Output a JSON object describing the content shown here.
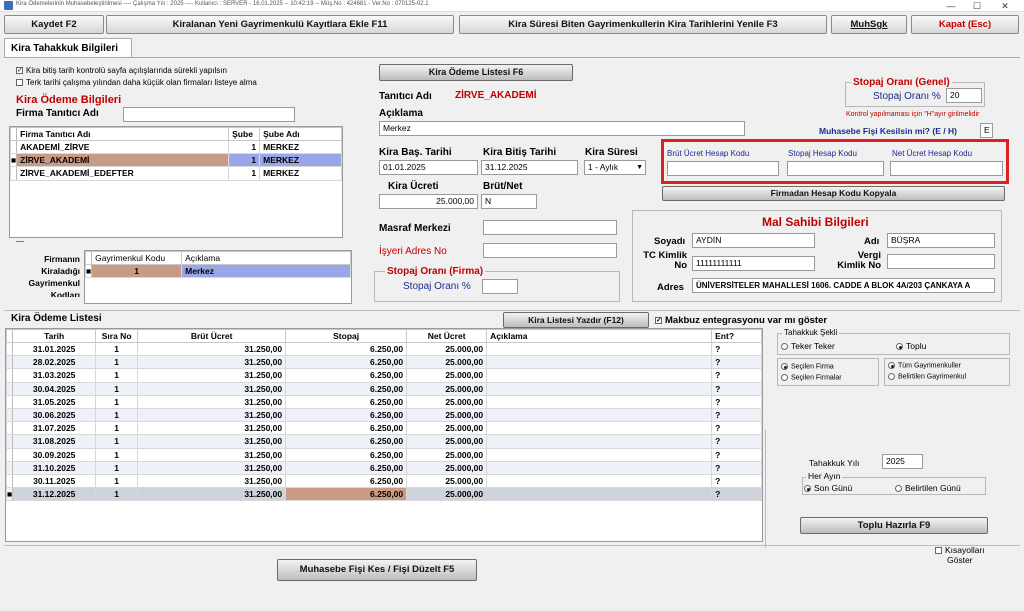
{
  "titlebar": {
    "text": "Kira Ödemelerinin Muhasebeleştirilmesi ---- Çalışma Yılı : 2025 ---- Kullanıcı : SERVER - 16.01.2025 -- 10:42:19 -- Müş.No : 424681 - Ver.No : 070125-02.1",
    "minimize": "—",
    "maximize": "☐",
    "close": "✕"
  },
  "toolbar": {
    "save": "Kaydet F2",
    "add_new": "Kiralanan Yeni Gayrimenkulü Kayıtlara Ekle F11",
    "renew": "Kira Süresi Biten Gayrimenkullerin Kira Tarihlerini Yenile F3",
    "muhsgk": "MuhSgk",
    "close": "Kapat (Esc)"
  },
  "tab": "Kira Tahakkuk Bilgileri",
  "options": {
    "check1": "Kira bitiş tarih kontrolü sayfa açılışlarında sürekli yapılsın",
    "check2": "Terk tarihi çalışma yılından daha küçük olan firmaları listeye alma"
  },
  "payment_info": {
    "heading": "Kira Ödeme Bilgileri",
    "firm_alias_label": "Firma Tanıtıcı Adı",
    "firm_alias_value": ""
  },
  "firm_grid": {
    "headers": [
      "Firma Tanıtıcı Adı",
      "Şube",
      "Şube Adı"
    ],
    "rows": [
      [
        "AKADEMİ_ZİRVE",
        "1",
        "MERKEZ"
      ],
      [
        "ZİRVE_AKADEMİ",
        "1",
        "MERKEZ"
      ],
      [
        "ZİRVE_AKADEMİ_EDEFTER",
        "1",
        "MERKEZ"
      ]
    ]
  },
  "property_grid": {
    "side_label": "Firmanın Kiraladığı Gayrimenkul Kodları",
    "headers": [
      "Gayrimenkul Kodu",
      "Açıklama"
    ],
    "rows": [
      [
        "1",
        "Merkez"
      ]
    ]
  },
  "list_button": "Kira Ödeme Listesi F6",
  "detail": {
    "alias_label": "Tanıtıcı Adı",
    "alias_value": "ZİRVE_AKADEMİ",
    "desc_label": "Açıklama",
    "desc_value": "Merkez",
    "start_label": "Kira Baş. Tarihi",
    "start_value": "01.01.2025",
    "end_label": "Kira Bitiş Tarihi",
    "end_value": "31.12.2025",
    "period_label": "Kira Süresi",
    "period_value": "1 - Aylık",
    "fee_label": "Kira Ücreti",
    "fee_value": "25.000,00",
    "gross_net_label": "Brüt/Net",
    "gross_net_value": "N",
    "cost_center_label": "Masraf Merkezi",
    "workplace_label": "İşyeri Adres No",
    "firm_rate_heading": "Stopaj Oranı (Firma)",
    "firm_rate_label": "Stopaj Oranı %",
    "firm_rate_value": ""
  },
  "general_rate": {
    "heading": "Stopaj Oranı (Genel)",
    "label": "Stopaj Oranı %",
    "value": "20",
    "note": "Kontrol yapılmaması için \"H\"ayır girilmelidir",
    "voucher_label": "Muhasebe Fişi Kesilsin mi? (E / H)",
    "voucher_value": "E"
  },
  "account_codes": {
    "gross": "Brüt Ücret Hesap Kodu",
    "withholding": "Stopaj Hesap Kodu",
    "net": "Net Ücret Hesap Kodu",
    "copy_button": "Firmadan Hesap Kodu Kopyala"
  },
  "owner": {
    "heading": "Mal Sahibi Bilgileri",
    "surname_label": "Soyadı",
    "surname_value": "AYDİN",
    "name_label": "Adı",
    "name_value": "BÜŞRA",
    "tc_label": "TC Kimlik No",
    "tc_value": "11111111111",
    "tax_label": "Vergi Kimlik No",
    "tax_value": "",
    "address_label": "Adres",
    "address_value": "ÜNİVERSİTELER MAHALLESİ 1606. CADDE A BLOK 4A/203 ÇANKAYA A"
  },
  "payments": {
    "heading": "Kira Ödeme Listesi",
    "print_button": "Kira Listesi Yazdır (F12)",
    "receipt_label": "Makbuz entegrasyonu var mı göster",
    "headers": [
      "Tarih",
      "Sıra No",
      "Brüt Ücret",
      "Stopaj",
      "Net Ücret",
      "Açıklama",
      "Ent?"
    ],
    "rows": [
      [
        "31.01.2025",
        "1",
        "31.250,00",
        "6.250,00",
        "25.000,00",
        "",
        "?"
      ],
      [
        "28.02.2025",
        "1",
        "31.250,00",
        "6.250,00",
        "25.000,00",
        "",
        "?"
      ],
      [
        "31.03.2025",
        "1",
        "31.250,00",
        "6.250,00",
        "25.000,00",
        "",
        "?"
      ],
      [
        "30.04.2025",
        "1",
        "31.250,00",
        "6.250,00",
        "25.000,00",
        "",
        "?"
      ],
      [
        "31.05.2025",
        "1",
        "31.250,00",
        "6.250,00",
        "25.000,00",
        "",
        "?"
      ],
      [
        "30.06.2025",
        "1",
        "31.250,00",
        "6.250,00",
        "25.000,00",
        "",
        "?"
      ],
      [
        "31.07.2025",
        "1",
        "31.250,00",
        "6.250,00",
        "25.000,00",
        "",
        "?"
      ],
      [
        "31.08.2025",
        "1",
        "31.250,00",
        "6.250,00",
        "25.000,00",
        "",
        "?"
      ],
      [
        "30.09.2025",
        "1",
        "31.250,00",
        "6.250,00",
        "25.000,00",
        "",
        "?"
      ],
      [
        "31.10.2025",
        "1",
        "31.250,00",
        "6.250,00",
        "25.000,00",
        "",
        "?"
      ],
      [
        "30.11.2025",
        "1",
        "31.250,00",
        "6.250,00",
        "25.000,00",
        "",
        "?"
      ],
      [
        "31.12.2025",
        "1",
        "31.250,00",
        "6.250,00",
        "25.000,00",
        "",
        "?"
      ]
    ]
  },
  "accrual": {
    "type_heading": "Tahakkuk Şekli",
    "single": "Teker Teker",
    "bulk": "Toplu",
    "selected_firm": "Seçilen Firma",
    "selected_firms": "Seçilen Firmalar",
    "all_properties": "Tüm Gayrimenkuller",
    "certain_properties": "Belirtilen Gayrimenkul",
    "year_label": "Tahakkuk Yılı",
    "year_value": "2025",
    "monthly_heading": "Her Ayın",
    "last_day": "Son Günü",
    "specified_day": "Belirtilen Günü",
    "bulk_button": "Toplu Hazırla F9"
  },
  "footer": {
    "voucher_button": "Muhasebe Fişi Kes / Fişi Düzelt F5",
    "shortcuts_label_1": "Kısayolları",
    "shortcuts_label_2": "Göster"
  }
}
